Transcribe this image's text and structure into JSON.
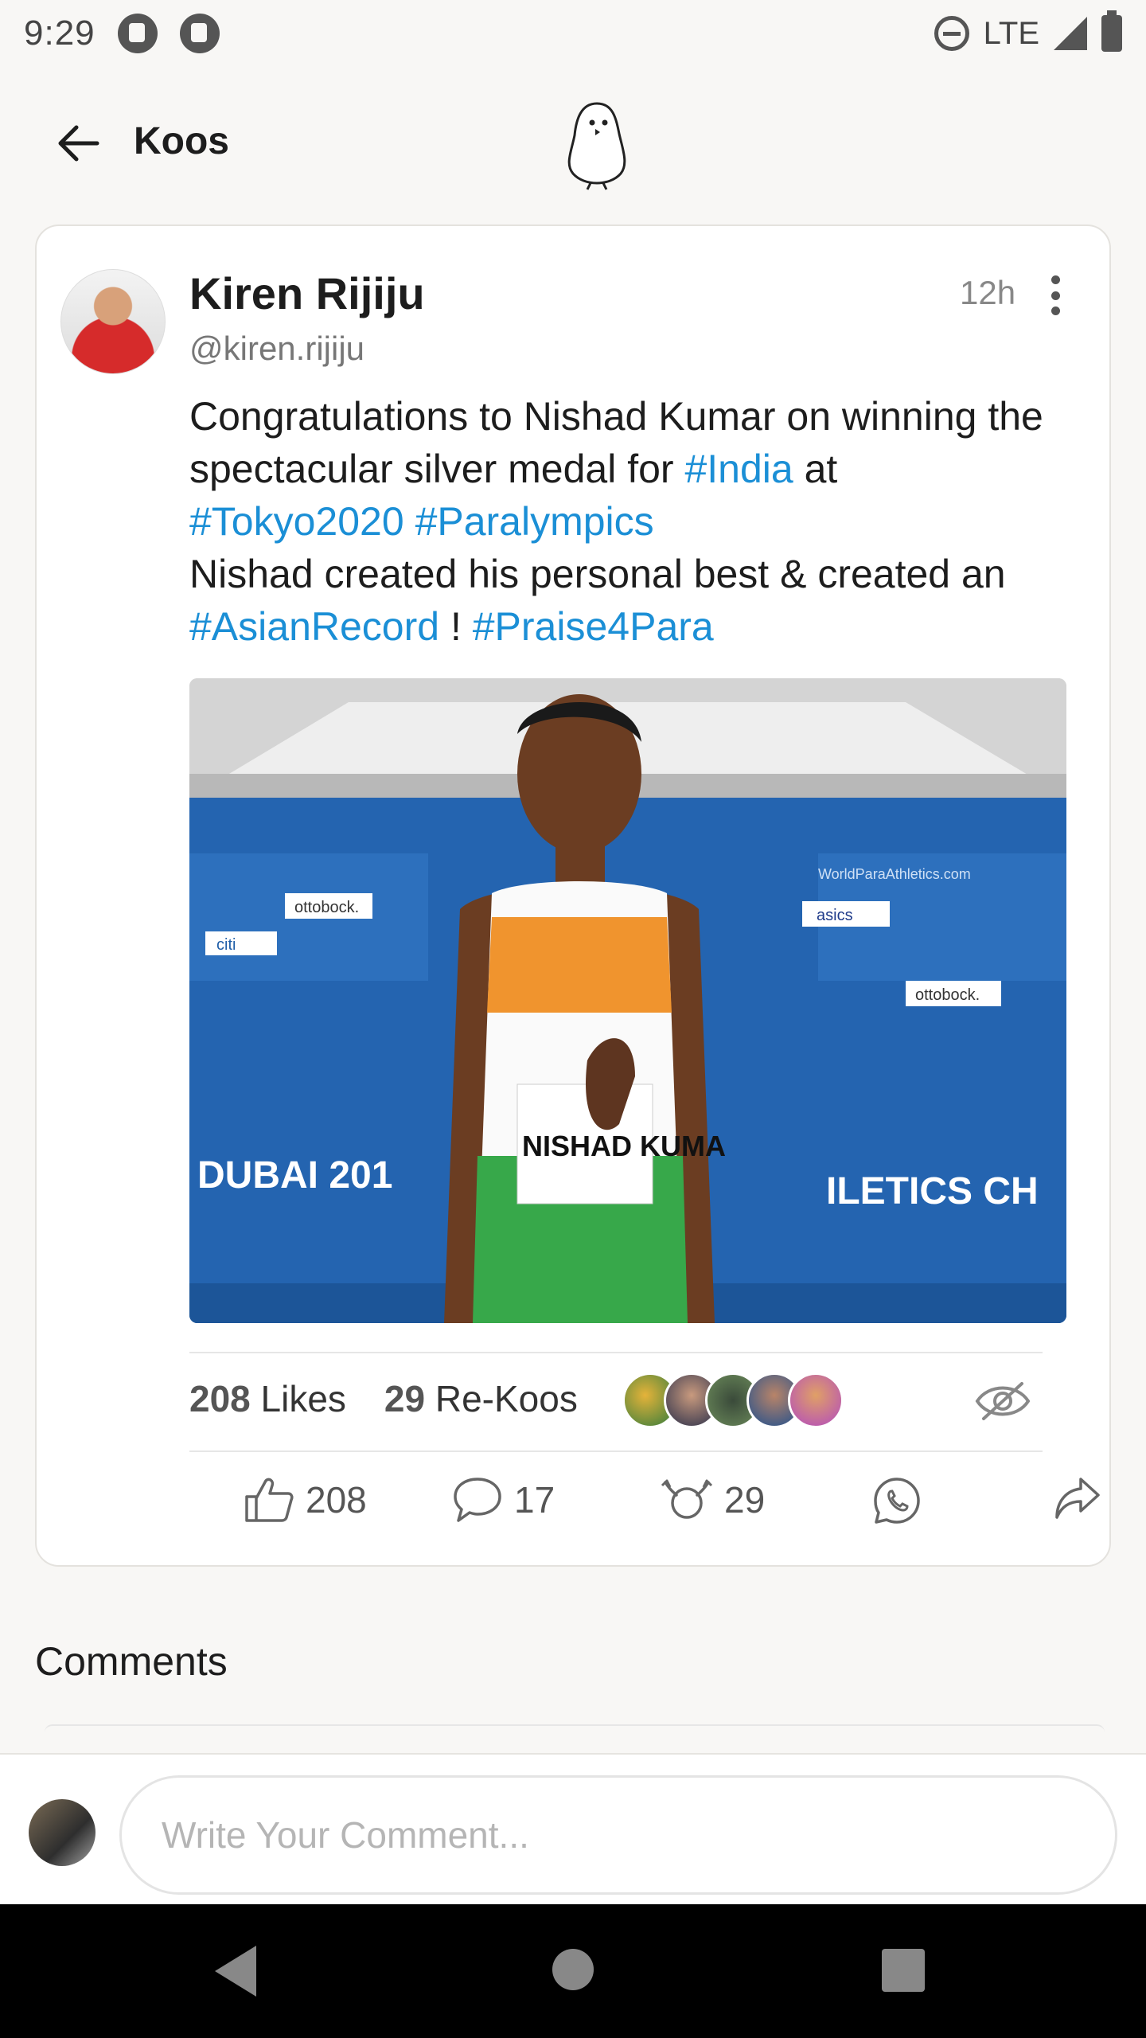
{
  "status_bar": {
    "time": "9:29",
    "network": "LTE"
  },
  "header": {
    "title": "Koos"
  },
  "post": {
    "author_name": "Kiren Rijiju",
    "author_handle": "@kiren.rijiju",
    "time_ago": "12h",
    "text": {
      "p1": "Congratulations to Nishad Kumar on winning the spectacular silver medal for ",
      "tag_india": "#India",
      "p2": " at ",
      "tag_tokyo": "#Tokyo2020",
      "tag_para": "#Paralympics",
      "p3": "Nishad created his personal best & created an ",
      "tag_asian": "#AsianRecord",
      "p4": " ! ",
      "tag_praise": "#Praise4Para"
    },
    "image": {
      "banner_left": "DUBAI 201",
      "banner_right": "ILETICS CH",
      "bib": "NISHAD KUMA",
      "sponsor_1": "ottobock.",
      "sponsor_2": "asics",
      "sponsor_3": "citi",
      "website": "WorldParaAthletics.com"
    },
    "stats": {
      "likes_count": "208",
      "likes_label": "Likes",
      "rekoos_count": "29",
      "rekoos_label": "Re-Koos"
    },
    "actions": {
      "like_count": "208",
      "comment_count": "17",
      "rekoo_count": "29"
    }
  },
  "comments": {
    "title": "Comments",
    "input_placeholder": "Write Your Comment..."
  },
  "colors": {
    "hashtag": "#1b8fd6",
    "background": "#f8f7f5",
    "card": "#ffffff",
    "navbar": "#000000"
  }
}
